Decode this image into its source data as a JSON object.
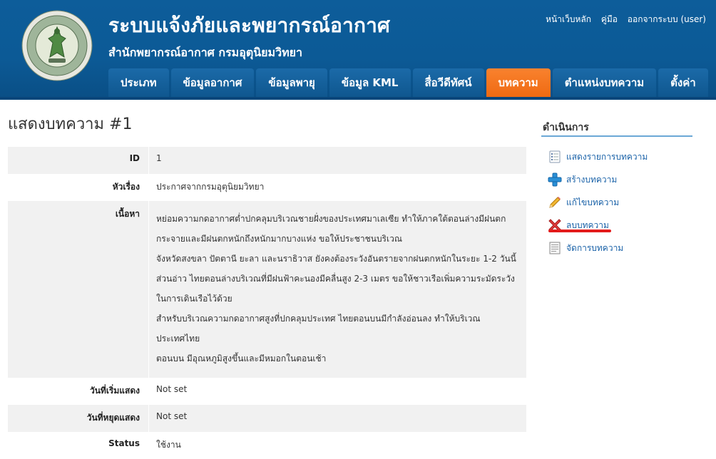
{
  "header": {
    "title": "ระบบแจ้งภัยและพยากรณ์อากาศ",
    "subtitle": "สำนักพยากรณ์อากาศ กรมอุตุนิยมวิทยา",
    "logo_text_top": "กรมอุตุนิยมวิทยา",
    "logo_text_bottom": "METEOROLOGICAL DEPARTMENT",
    "links": [
      "หน้าเว็บหลัก",
      "คู่มือ",
      "ออกจากระบบ (user)"
    ],
    "colors": {
      "bar": "#0d5d9a",
      "active_tab": "#f57a22"
    }
  },
  "nav": {
    "tabs": [
      "ประเภท",
      "ข้อมูลอากาศ",
      "ข้อมูลพายุ",
      "ข้อมูล KML",
      "สื่อวีดีทัศน์",
      "บทความ",
      "ตำแหน่งบทความ",
      "ตั้งค่า"
    ],
    "active": "บทความ"
  },
  "page": {
    "title": "แสดงบทความ #1"
  },
  "detail": {
    "id_label": "ID",
    "id_value": "1",
    "subject_label": "หัวเรื่อง",
    "subject_value": "ประกาศจากกรมอุตุนิยมวิทยา",
    "content_label": "เนื้อหา",
    "content_lines": [
      "หย่อมความกดอากาศต่ำปกคลุมบริเวณชายฝั่งของประเทศมาเลเซีย ทำให้ภาคใต้ตอนล่างมีฝนตก",
      "กระจายและมีฝนตกหนักถึงหนักมากบางแห่ง ขอให้ประชาชนบริเวณ",
      "จังหวัดสงขลา ปัตตานี ยะลา และนราธิวาส ยังคงต้องระวังอันตรายจากฝนตกหนักในระยะ 1-2 วันนี้",
      "ส่วนอ่าว ไทยตอนล่างบริเวณที่มีฝนฟ้าคะนองมีคลื่นสูง 2-3 เมตร ขอให้ชาวเรือเพิ่มความระมัดระวัง",
      "ในการเดินเรือไว้ด้วย",
      "สำหรับบริเวณความกดอากาศสูงที่ปกคลุมประเทศ ไทยตอนบนมีกำลังอ่อนลง ทำให้บริเวณประเทศไทย",
      "ตอนบน มีอุณหภูมิสูงขึ้นและมีหมอกในตอนเช้า"
    ],
    "start_label": "วันที่เริ่มแสดง",
    "start_value": "Not set",
    "end_label": "วันที่หยุดแสดง",
    "end_value": "Not set",
    "status_label": "Status",
    "status_value": "ใช้งาน"
  },
  "sidebar": {
    "title": "ดำเนินการ",
    "items": [
      {
        "label": "แสดงรายการบทความ",
        "icon": "list-icon"
      },
      {
        "label": "สร้างบทความ",
        "icon": "plus-icon"
      },
      {
        "label": "แก้ไขบทความ",
        "icon": "pencil-icon"
      },
      {
        "label": "ลบบทความ",
        "icon": "delete-icon"
      },
      {
        "label": "จัดการบทความ",
        "icon": "document-icon"
      }
    ]
  }
}
